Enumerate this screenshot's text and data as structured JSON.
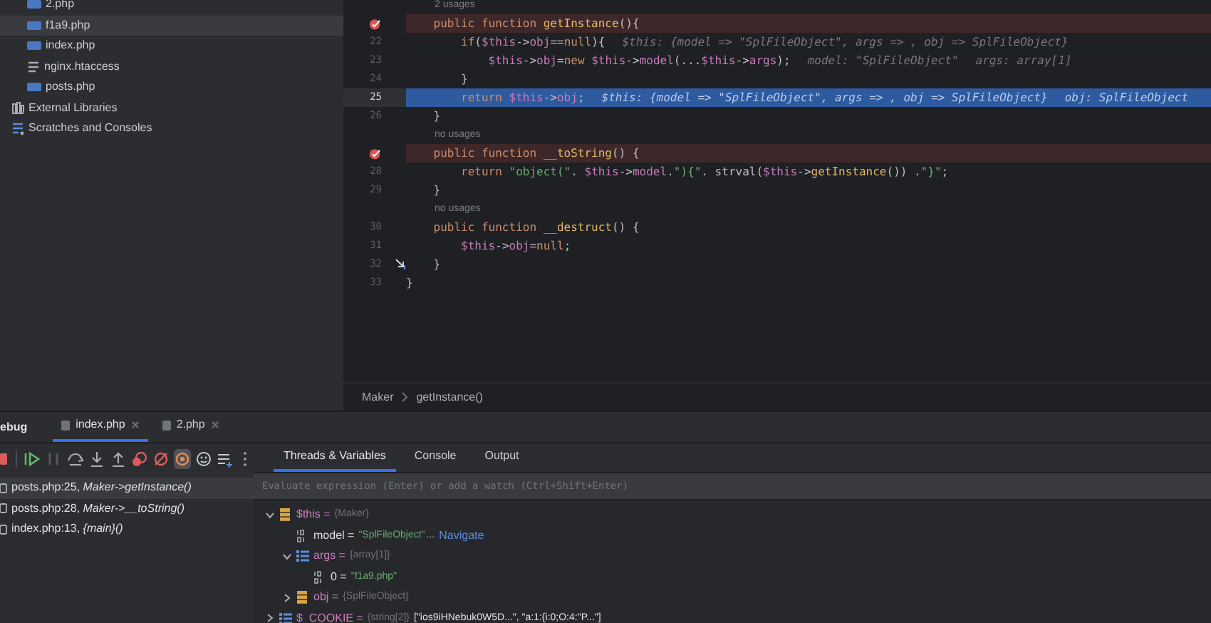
{
  "project_tree": {
    "files": [
      {
        "label": "2.php",
        "kind": "php",
        "selected": false
      },
      {
        "label": "f1a9.php",
        "kind": "php",
        "selected": true
      },
      {
        "label": "index.php",
        "kind": "php",
        "selected": false
      },
      {
        "label": "nginx.htaccess",
        "kind": "text",
        "selected": false
      },
      {
        "label": "posts.php",
        "kind": "php",
        "selected": false
      }
    ],
    "roots": [
      {
        "label": "External Libraries",
        "kind": "library",
        "selected": false
      },
      {
        "label": "Scratches and Consoles",
        "kind": "scratches",
        "selected": false
      }
    ]
  },
  "editor": {
    "lines": [
      {
        "kind": "usages",
        "text": "2 usages"
      },
      {
        "kind": "code",
        "breakpoint": true,
        "current": false,
        "step_marker": false,
        "segments": [
          {
            "kind": "kw",
            "text": "    public function "
          },
          {
            "kind": "fn",
            "text": "getInstance"
          },
          {
            "kind": "plain",
            "text": "(){"
          }
        ]
      },
      {
        "kind": "code",
        "number": "22",
        "breakpoint": false,
        "current": false,
        "step_marker": false,
        "segments": [
          {
            "kind": "kw",
            "text": "        if"
          },
          {
            "kind": "plain",
            "text": "("
          },
          {
            "kind": "var",
            "text": "$this"
          },
          {
            "kind": "plain",
            "text": "->"
          },
          {
            "kind": "var",
            "text": "obj"
          },
          {
            "kind": "plain",
            "text": "=="
          },
          {
            "kind": "kw",
            "text": "null"
          },
          {
            "kind": "plain",
            "text": "){"
          }
        ],
        "hints": [
          "$this: {model => \"SplFileObject\", args => , obj => SplFileObject}"
        ]
      },
      {
        "kind": "code",
        "number": "23",
        "breakpoint": false,
        "current": false,
        "step_marker": false,
        "segments": [
          {
            "kind": "var",
            "text": "            $this"
          },
          {
            "kind": "plain",
            "text": "->"
          },
          {
            "kind": "var",
            "text": "obj"
          },
          {
            "kind": "plain",
            "text": "="
          },
          {
            "kind": "kw",
            "text": "new "
          },
          {
            "kind": "var",
            "text": "$this"
          },
          {
            "kind": "plain",
            "text": "->"
          },
          {
            "kind": "var",
            "text": "model"
          },
          {
            "kind": "plain",
            "text": "(..."
          },
          {
            "kind": "var",
            "text": "$this"
          },
          {
            "kind": "plain",
            "text": "->"
          },
          {
            "kind": "var",
            "text": "args"
          },
          {
            "kind": "plain",
            "text": ");"
          }
        ],
        "hints": [
          "model: \"SplFileObject\"",
          "args: array[1]"
        ]
      },
      {
        "kind": "code",
        "number": "24",
        "breakpoint": false,
        "current": false,
        "step_marker": false,
        "segments": [
          {
            "kind": "plain",
            "text": "        }"
          }
        ]
      },
      {
        "kind": "code",
        "number": "25",
        "breakpoint": false,
        "current": true,
        "step_marker": false,
        "segments": [
          {
            "kind": "kw",
            "text": "        return "
          },
          {
            "kind": "var",
            "text": "$this"
          },
          {
            "kind": "plain",
            "text": "->"
          },
          {
            "kind": "var",
            "text": "obj"
          },
          {
            "kind": "plain",
            "text": ";"
          }
        ],
        "hints": [
          "$this: {model => \"SplFileObject\", args => , obj => SplFileObject}",
          "obj: SplFileObject"
        ]
      },
      {
        "kind": "code",
        "number": "26",
        "breakpoint": false,
        "current": false,
        "step_marker": false,
        "segments": [
          {
            "kind": "plain",
            "text": "    }"
          }
        ]
      },
      {
        "kind": "usages",
        "text": "no usages"
      },
      {
        "kind": "code",
        "breakpoint": true,
        "current": false,
        "step_marker": false,
        "segments": [
          {
            "kind": "kw",
            "text": "    public function "
          },
          {
            "kind": "fn",
            "text": "__toString"
          },
          {
            "kind": "plain",
            "text": "() {"
          }
        ]
      },
      {
        "kind": "code",
        "number": "28",
        "breakpoint": false,
        "current": false,
        "step_marker": false,
        "segments": [
          {
            "kind": "kw",
            "text": "        return "
          },
          {
            "kind": "str",
            "text": "\"object(\""
          },
          {
            "kind": "plain",
            "text": ". "
          },
          {
            "kind": "var",
            "text": "$this"
          },
          {
            "kind": "plain",
            "text": "->"
          },
          {
            "kind": "var",
            "text": "model"
          },
          {
            "kind": "plain",
            "text": "."
          },
          {
            "kind": "str",
            "text": "\"){\""
          },
          {
            "kind": "plain",
            "text": ". strval("
          },
          {
            "kind": "var",
            "text": "$this"
          },
          {
            "kind": "plain",
            "text": "->"
          },
          {
            "kind": "fn",
            "text": "getInstance"
          },
          {
            "kind": "plain",
            "text": "()) ."
          },
          {
            "kind": "str",
            "text": "\"}\""
          },
          {
            "kind": "plain",
            "text": ";"
          }
        ]
      },
      {
        "kind": "code",
        "number": "29",
        "breakpoint": false,
        "current": false,
        "step_marker": false,
        "segments": [
          {
            "kind": "plain",
            "text": "    }"
          }
        ]
      },
      {
        "kind": "usages",
        "text": "no usages"
      },
      {
        "kind": "code",
        "number": "30",
        "breakpoint": false,
        "current": false,
        "step_marker": false,
        "segments": [
          {
            "kind": "kw",
            "text": "    public function "
          },
          {
            "kind": "fn",
            "text": "__destruct"
          },
          {
            "kind": "plain",
            "text": "() {"
          }
        ]
      },
      {
        "kind": "code",
        "number": "31",
        "breakpoint": false,
        "current": false,
        "step_marker": false,
        "segments": [
          {
            "kind": "var",
            "text": "        $this"
          },
          {
            "kind": "plain",
            "text": "->"
          },
          {
            "kind": "var",
            "text": "obj"
          },
          {
            "kind": "plain",
            "text": "="
          },
          {
            "kind": "kw",
            "text": "null"
          },
          {
            "kind": "plain",
            "text": ";"
          }
        ]
      },
      {
        "kind": "code",
        "number": "32",
        "breakpoint": false,
        "current": false,
        "step_marker": true,
        "segments": [
          {
            "kind": "plain",
            "text": "    }"
          }
        ]
      },
      {
        "kind": "code",
        "number": "33",
        "breakpoint": false,
        "current": false,
        "step_marker": false,
        "segments": [
          {
            "kind": "plain",
            "text": "}"
          }
        ]
      }
    ],
    "breadcrumb": [
      "Maker",
      "getInstance()"
    ]
  },
  "debug": {
    "title": "ebug",
    "tabs": [
      {
        "label": "index.php",
        "selected": true
      },
      {
        "label": "2.php",
        "selected": false
      }
    ],
    "toolbar": [
      {
        "kind": "stop",
        "selected": false
      },
      {
        "kind": "resume",
        "selected": false
      },
      {
        "kind": "pause",
        "selected": false
      },
      {
        "kind": "step_over",
        "selected": false
      },
      {
        "kind": "step_into",
        "selected": false
      },
      {
        "kind": "step_out",
        "selected": false
      },
      {
        "kind": "breakpoints",
        "selected": false
      },
      {
        "kind": "mute",
        "selected": false
      },
      {
        "kind": "target",
        "selected": true
      },
      {
        "kind": "smiley",
        "selected": false
      },
      {
        "kind": "list",
        "selected": false
      },
      {
        "kind": "more",
        "selected": false
      }
    ],
    "frames": [
      {
        "text": "posts.php:25, *Maker->getInstance()*",
        "selected": true
      },
      {
        "text": "posts.php:28, *Maker->__toString()*",
        "selected": false
      },
      {
        "text": "index.php:13, *{main}()*",
        "selected": false
      }
    ],
    "panel_tabs": [
      {
        "label": "Threads & Variables",
        "selected": true
      },
      {
        "label": "Console",
        "selected": false
      },
      {
        "label": "Output",
        "selected": false
      }
    ],
    "evaluate": {
      "placeholder": "Evaluate expression (Enter) or add a watch (Ctrl+Shift+Enter)"
    },
    "variables": [
      {
        "kind": "object",
        "name": "$this =",
        "type": "{Maker}",
        "expanded": true,
        "children": [
          {
            "kind": "string",
            "name": "model =",
            "value": "\"SplFileObject\"",
            "more": "...",
            "link": "Navigate"
          },
          {
            "kind": "array",
            "name": "args =",
            "type": "{array[1]}",
            "expanded": true,
            "children": [
              {
                "kind": "string",
                "name": "0 =",
                "value": "\"f1a9.php\""
              }
            ]
          },
          {
            "kind": "object",
            "name": "obj =",
            "type": "{SplFileObject}",
            "expanded": false
          }
        ]
      },
      {
        "kind": "array",
        "name": "$_COOKIE =",
        "type": "{string[2]}",
        "extra": "[\"ios9iHNebuk0W5D...\", \"a:1:{i:0;O:4:\"P...\"]",
        "expanded": false
      }
    ]
  }
}
